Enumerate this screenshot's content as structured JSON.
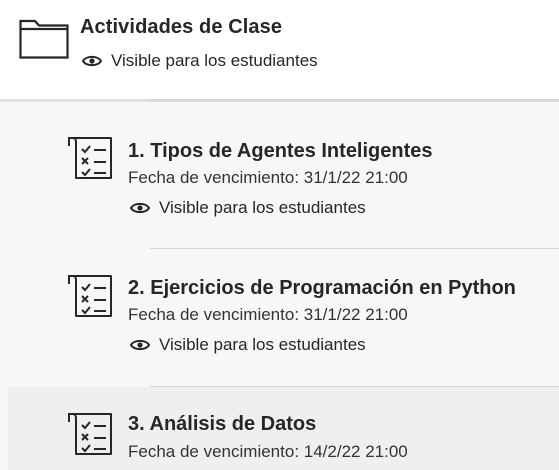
{
  "folder": {
    "title": "Actividades de Clase",
    "visibility": "Visible para los estudiantes"
  },
  "items": [
    {
      "title": "1. Tipos de Agentes Inteligentes",
      "due": "Fecha de vencimiento: 31/1/22 21:00",
      "visibility": "Visible para los estudiantes"
    },
    {
      "title": "2. Ejercicios de Programación en Python",
      "due": "Fecha de vencimiento: 31/1/22 21:00",
      "visibility": "Visible para los estudiantes"
    },
    {
      "title": "3. Análisis de Datos",
      "due": "Fecha de vencimiento: 14/2/22 21:00"
    }
  ],
  "colors": {
    "text": "#262626",
    "background": "#f7f7f7",
    "selected_row": "#efefef"
  }
}
